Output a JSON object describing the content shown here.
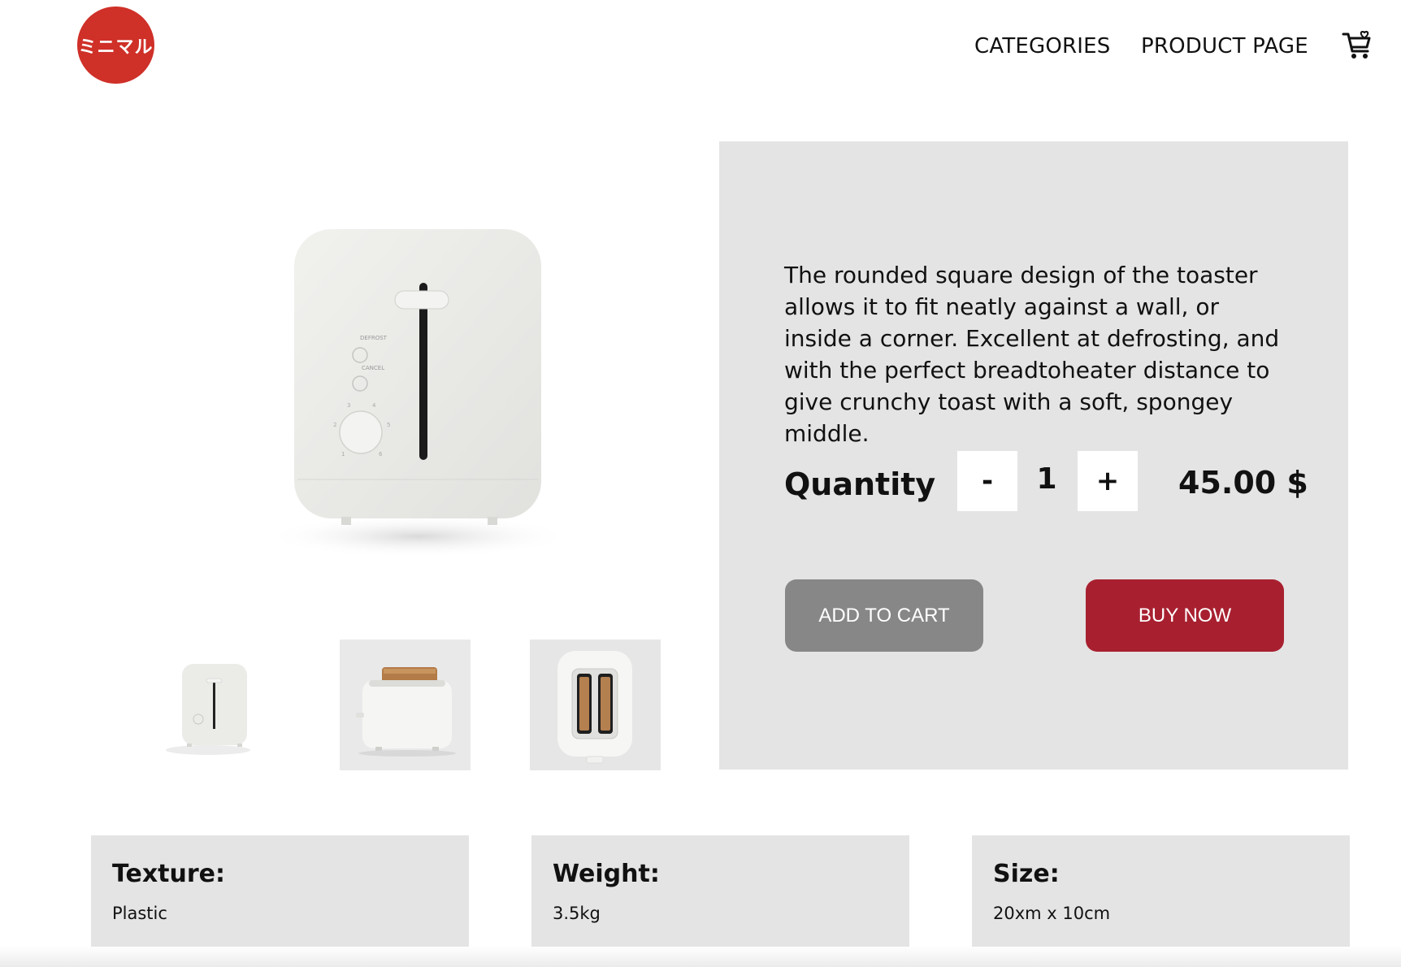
{
  "header": {
    "logo_text": "ミニマル",
    "nav": {
      "categories": "CATEGORIES",
      "product_page": "PRODUCT PAGE"
    },
    "cart_icon": "shopping-cart-icon"
  },
  "product": {
    "description": "The rounded square design of the toaster allows it to fit neatly against a wall, or inside a corner. Excellent at defrosting, and with the perfect breadtoheater distance to give crunchy toast with a soft, spongey middle.",
    "quantity_label": "Quantity",
    "decrement_label": "-",
    "increment_label": "+",
    "quantity": "1",
    "price": "45.00 $",
    "add_to_cart_label": "ADD TO CART",
    "buy_now_label": "BUY NOW"
  },
  "toaster_labels": {
    "defrost": "DEFROST",
    "cancel": "CANCEL",
    "dial": [
      "1",
      "2",
      "3",
      "4",
      "5",
      "6"
    ]
  },
  "specs": [
    {
      "title": "Texture:",
      "value": "Plastic"
    },
    {
      "title": "Weight:",
      "value": "3.5kg"
    },
    {
      "title": "Size:",
      "value": "20xm x 10cm"
    }
  ],
  "colors": {
    "logo": "#cf3028",
    "panel": "#e4e4e4",
    "add_to_cart": "#878787",
    "buy_now": "#a82030"
  }
}
